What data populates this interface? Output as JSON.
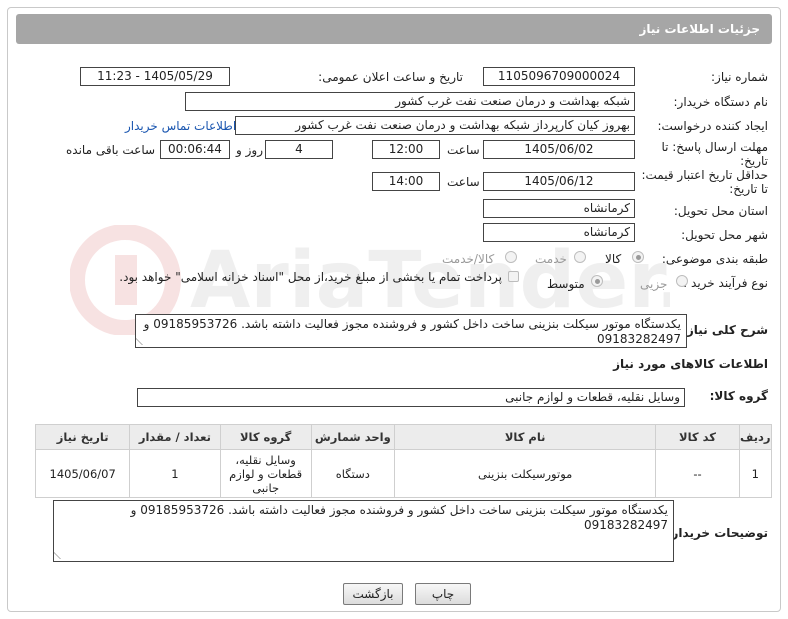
{
  "header": {
    "title": "جزئیات اطلاعات نیاز"
  },
  "fields": {
    "need_number_label": "شماره نیاز:",
    "need_number": "1105096709000024",
    "announce_label": "تاریخ و ساعت اعلان عمومی:",
    "announce_value": "1405/05/29 - 11:23",
    "buyer_org_label": "نام دستگاه خریدار:",
    "buyer_org": "شبکه بهداشت و درمان صنعت نفت غرب کشور",
    "creator_label": "ایجاد کننده درخواست:",
    "creator": "بهروز کیان کارپرداز شبکه بهداشت و درمان صنعت نفت غرب کشور",
    "contact_link": "اطلاعات تماس خریدار",
    "deadline_label_1": "مهلت ارسال پاسخ: تا",
    "deadline_label_2": "تاریخ:",
    "deadline_date": "1405/06/02",
    "time_label": "ساعت",
    "deadline_time": "12:00",
    "days_value": "4",
    "days_label": "روز و",
    "remaining_time": "00:06:44",
    "remaining_label": "ساعت باقی مانده",
    "validity_label_1": "حداقل تاریخ اعتبار قیمت:",
    "validity_label_2": "تا تاریخ:",
    "validity_date": "1405/06/12",
    "validity_time": "14:00",
    "province_label": "استان محل تحویل:",
    "province": "کرمانشاه",
    "city_label": "شهر محل تحویل:",
    "city": "کرمانشاه",
    "category_label": "طبقه بندی موضوعی:",
    "category_options": [
      "کالا",
      "خدمت",
      "کالا/خدمت"
    ],
    "process_label": "نوع فرآیند خرید :",
    "process_options": [
      "جزیی",
      "متوسط"
    ],
    "payment_note": "پرداخت تمام یا بخشی از مبلغ خرید،از محل \"اسناد خزانه اسلامی\" خواهد بود."
  },
  "description": {
    "label": "شرح کلی نیاز:",
    "text": "یکدستگاه موتور سیکلت بنزینی ساخت داخل کشور و فروشنده مجوز فعالیت داشته باشد. 09185953726 و 09183282497"
  },
  "goods": {
    "section_title": "اطلاعات کالاهای مورد نیاز",
    "group_label": "گروه کالا:",
    "group_value": "وسایل نقلیه، قطعات و لوازم جانبی",
    "columns": [
      "ردیف",
      "کد کالا",
      "نام کالا",
      "واحد شمارش",
      "گروه کالا",
      "تعداد / مقدار",
      "تاریخ نیاز"
    ],
    "rows": [
      {
        "row": "1",
        "code": "--",
        "name": "موتورسیکلت بنزینی",
        "unit": "دستگاه",
        "group": "وسایل نقلیه، قطعات و لوازم جانبی",
        "qty": "1",
        "date": "1405/06/07"
      }
    ]
  },
  "buyer_notes": {
    "label": "توضیحات خریدار:",
    "text": "یکدستگاه موتور سیکلت بنزینی ساخت داخل کشور و فروشنده مجوز فعالیت داشته باشد. 09185953726 و 09183282497"
  },
  "buttons": {
    "print": "چاپ",
    "back": "بازگشت"
  },
  "watermark": {
    "text": "AriaTender.net"
  }
}
